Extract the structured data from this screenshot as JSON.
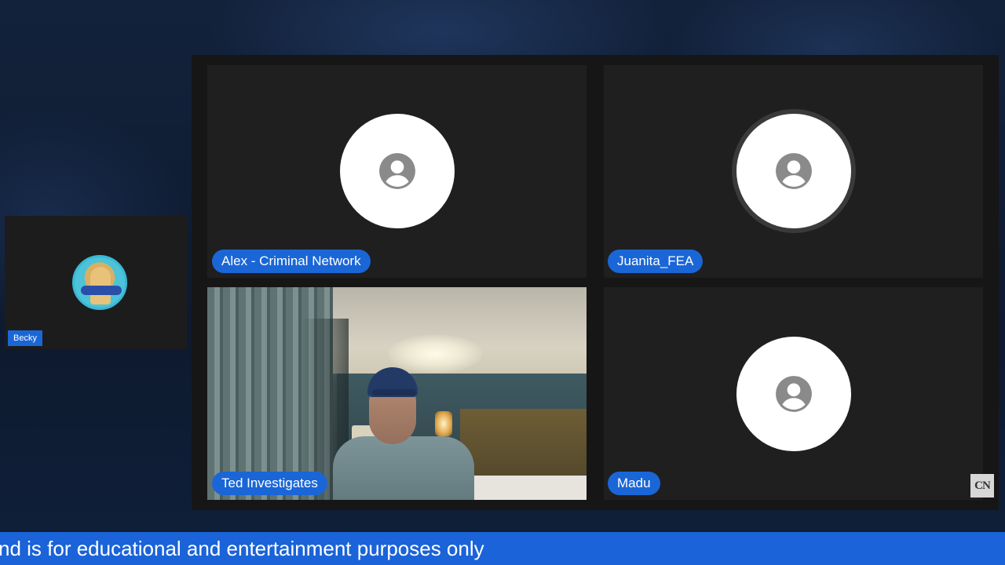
{
  "participants": {
    "side": {
      "name": "Becky"
    },
    "tile1": {
      "name": "Alex - Criminal Network"
    },
    "tile2": {
      "name": "Juanita_FEA"
    },
    "tile3": {
      "name": "Ted Investigates"
    },
    "tile4": {
      "name": "Madu"
    }
  },
  "icons": {
    "avatar_placeholder": "person-icon",
    "watermark": "channel-logo"
  },
  "ticker": {
    "text": "nd is for educational and entertainment purposes only"
  },
  "colors": {
    "accent": "#1a66d6",
    "tile_bg": "#1f1f1f",
    "page_bg": "#0f1b30"
  }
}
